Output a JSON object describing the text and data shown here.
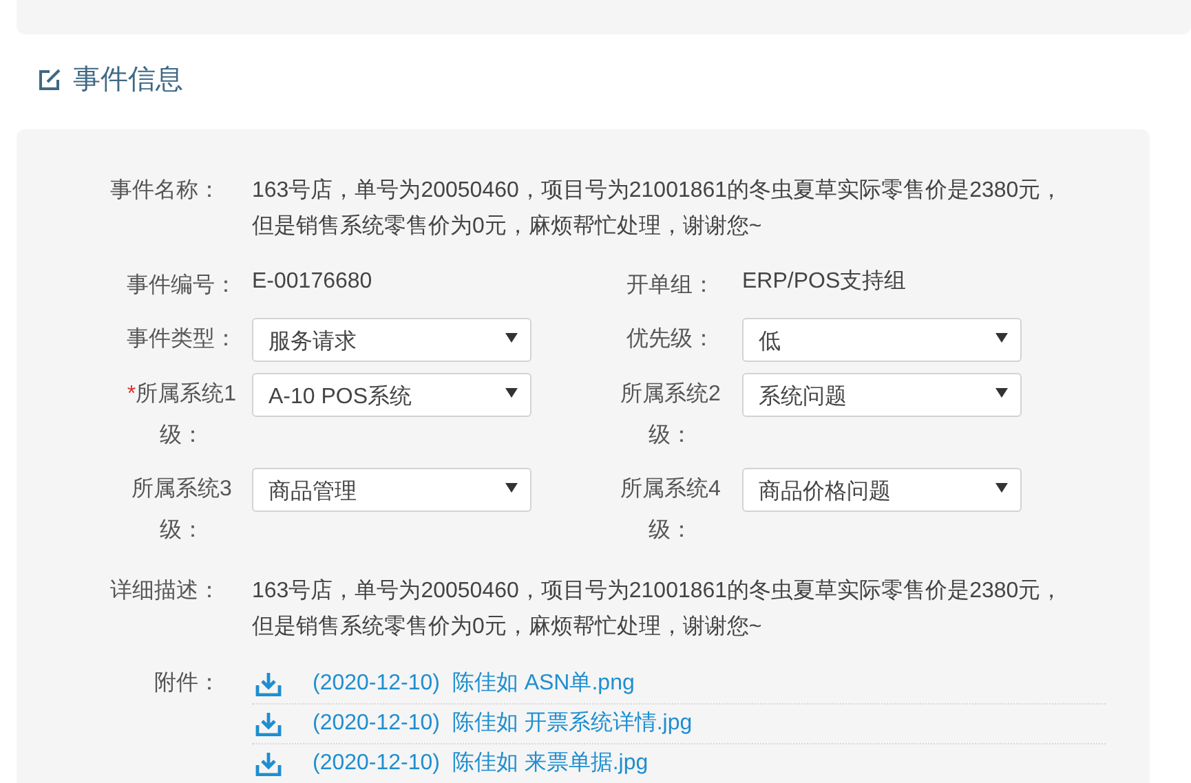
{
  "section_title": "事件信息",
  "event_name": {
    "label": "事件名称：",
    "value": "163号店，单号为20050460，项目号为21001861的冬虫夏草实际零售价是2380元，但是销售系统零售价为0元，麻烦帮忙处理，谢谢您~"
  },
  "fields": [
    {
      "kind": "text",
      "label": "事件编号：",
      "value": "E-00176680"
    },
    {
      "kind": "text",
      "label": "开单组：",
      "value": "ERP/POS支持组"
    },
    {
      "kind": "select",
      "label": "事件类型：",
      "value": "服务请求"
    },
    {
      "kind": "select",
      "label": "优先级：",
      "value": "低"
    },
    {
      "kind": "select",
      "marker": "*",
      "label": "所属系统1级：",
      "value": "A-10 POS系统"
    },
    {
      "kind": "select",
      "label": "所属系统2级：",
      "value": "系统问题"
    },
    {
      "kind": "select",
      "label": "所属系统3级：",
      "value": "商品管理"
    },
    {
      "kind": "select",
      "label": "所属系统4级：",
      "value": "商品价格问题"
    }
  ],
  "description": {
    "label": "详细描述：",
    "value": "163号店，单号为20050460，项目号为21001861的冬虫夏草实际零售价是2380元，但是销售系统零售价为0元，麻烦帮忙处理，谢谢您~"
  },
  "attachments": {
    "label": "附件：",
    "files": [
      {
        "name": "(2020-12-10)  陈佳如 ASN单.png"
      },
      {
        "name": "(2020-12-10)  陈佳如 开票系统详情.jpg"
      },
      {
        "name": "(2020-12-10)  陈佳如 来票单据.jpg"
      }
    ]
  }
}
